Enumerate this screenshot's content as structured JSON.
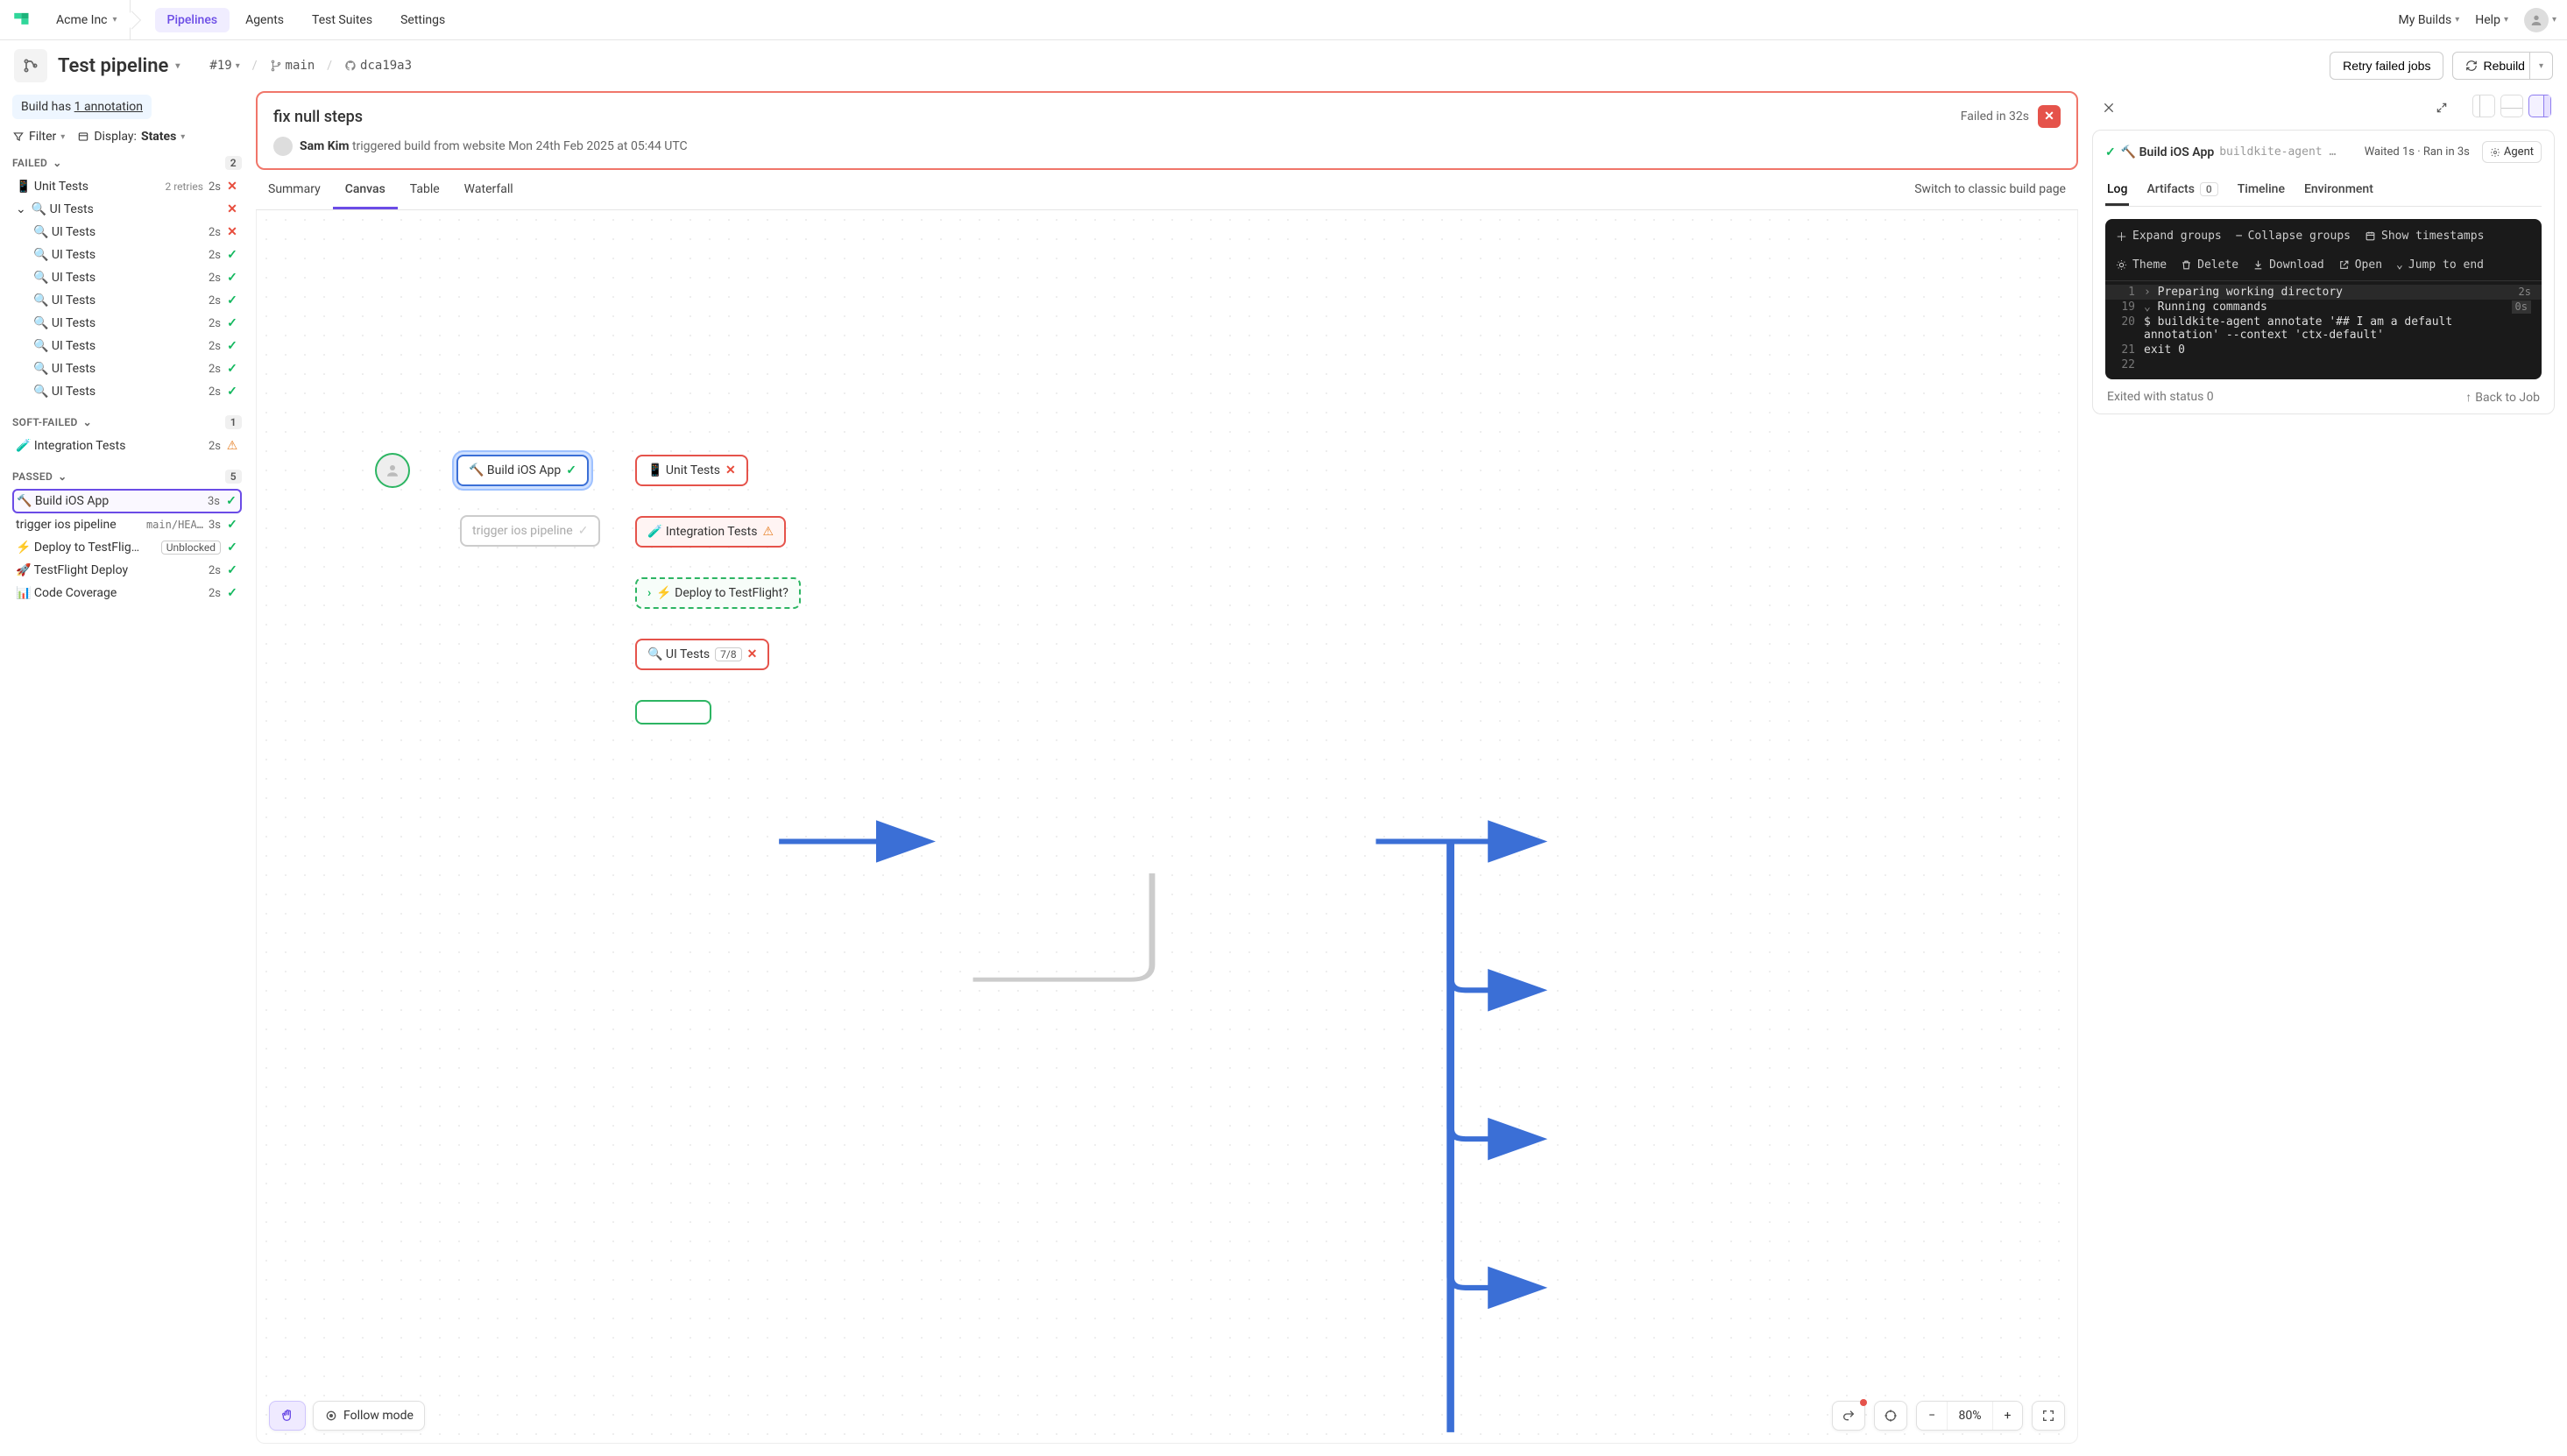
{
  "org": "Acme Inc",
  "nav": {
    "pipelines": "Pipelines",
    "agents": "Agents",
    "suites": "Test Suites",
    "settings": "Settings"
  },
  "right_nav": {
    "mybuilds": "My Builds",
    "help": "Help"
  },
  "pipeline": {
    "name": "Test pipeline"
  },
  "crumbs": {
    "build_num": "#19",
    "branch": "main",
    "commit": "dca19a3"
  },
  "actions": {
    "retry": "Retry failed jobs",
    "rebuild": "Rebuild"
  },
  "annotation_banner": {
    "pre": "Build has ",
    "link": "1 annotation"
  },
  "filters": {
    "filter": "Filter",
    "display_label": "Display:",
    "display_value": "States"
  },
  "groups": {
    "failed": {
      "label": "FAILED",
      "count": "2"
    },
    "soft": {
      "label": "SOFT-FAILED",
      "count": "1"
    },
    "passed": {
      "label": "PASSED",
      "count": "5"
    }
  },
  "jobs": {
    "unit": {
      "name": "📱 Unit Tests",
      "retries": "2 retries",
      "time": "2s"
    },
    "ui_parent": {
      "name": "🔍 UI Tests"
    },
    "ui1": {
      "name": "🔍 UI Tests",
      "time": "2s"
    },
    "ui2": {
      "name": "🔍 UI Tests",
      "time": "2s"
    },
    "ui3": {
      "name": "🔍 UI Tests",
      "time": "2s"
    },
    "ui4": {
      "name": "🔍 UI Tests",
      "time": "2s"
    },
    "ui5": {
      "name": "🔍 UI Tests",
      "time": "2s"
    },
    "ui6": {
      "name": "🔍 UI Tests",
      "time": "2s"
    },
    "ui7": {
      "name": "🔍 UI Tests",
      "time": "2s"
    },
    "ui8": {
      "name": "🔍 UI Tests",
      "time": "2s"
    },
    "integ": {
      "name": "🧪 Integration Tests",
      "time": "2s"
    },
    "build_ios": {
      "name": "🔨 Build iOS App",
      "time": "3s"
    },
    "trigger": {
      "name": "trigger ios pipeline",
      "ref": "main/HEA…",
      "time": "3s"
    },
    "deploy_tf": {
      "name": "⚡ Deploy to TestFlig…",
      "badge": "Unblocked"
    },
    "tf_deploy": {
      "name": "🚀 TestFlight Deploy",
      "time": "2s"
    },
    "coverage": {
      "name": "📊 Code Coverage",
      "time": "2s"
    }
  },
  "build_header": {
    "title": "fix null steps",
    "status": "Failed in 32s",
    "person": "Sam Kim",
    "trigger_text": "triggered build from website Mon 24th Feb 2025 at 05:44 UTC"
  },
  "center_tabs": {
    "summary": "Summary",
    "canvas": "Canvas",
    "table": "Table",
    "waterfall": "Waterfall",
    "classic": "Switch to classic build page"
  },
  "nodes": {
    "build": "🔨 Build iOS App",
    "trigger": "trigger ios pipeline",
    "unit": "📱 Unit Tests",
    "integ": "🧪 Integration Tests",
    "deploy": "⚡ Deploy to TestFlight?",
    "ui": "🔍 UI Tests",
    "ui_badge": "7/8"
  },
  "canvas_tools": {
    "follow": "Follow mode",
    "zoom": "80%"
  },
  "drawer": {
    "title": "🔨 Build iOS App",
    "agent_cmd": "buildkite-agent an…",
    "meta": "Waited 1s · Ran in 3s",
    "agent_btn": "Agent",
    "tabs": {
      "log": "Log",
      "artifacts": "Artifacts",
      "artifacts_count": "0",
      "timeline": "Timeline",
      "env": "Environment"
    },
    "toolbar": {
      "expand": "Expand groups",
      "collapse": "Collapse groups",
      "ts": "Show timestamps",
      "theme": "Theme",
      "delete": "Delete",
      "download": "Download",
      "open": "Open",
      "jump": "Jump to end"
    },
    "log": {
      "r1_ln": "1",
      "r1_t": "Preparing working directory",
      "r1_time": "2s",
      "r2_ln": "19",
      "r2_t": "Running commands",
      "r2_time": "0s",
      "r3_ln": "20",
      "r3_t": "$ buildkite-agent annotate '## I am a default annotation' --context 'ctx-default'",
      "r4_ln": "21",
      "r4_t": "exit 0",
      "r5_ln": "22"
    },
    "exit": "Exited with status 0",
    "back": "Back to Job"
  }
}
